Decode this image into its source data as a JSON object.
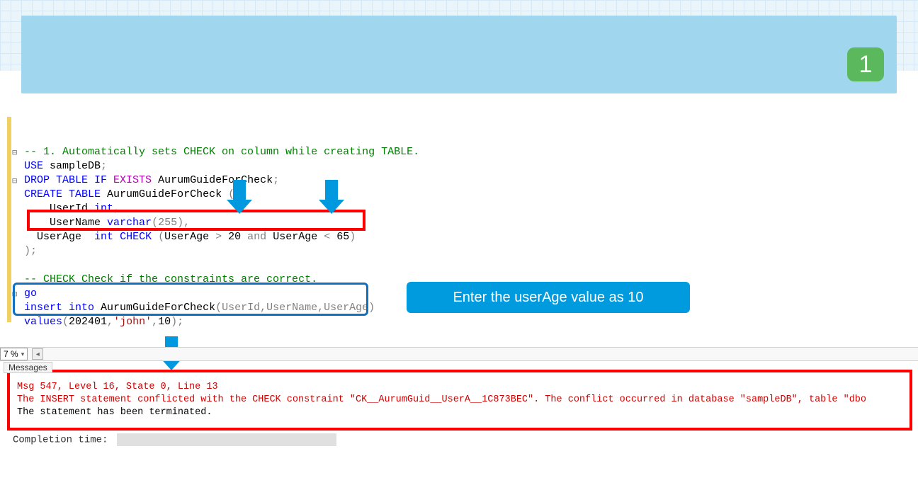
{
  "header": {
    "step_number": "1"
  },
  "code": {
    "comment1": "-- 1. Automatically sets CHECK on column while creating TABLE.",
    "use_kw": "USE",
    "use_db": "sampleDB",
    "drop_kw": "DROP TABLE IF",
    "exists_kw": "EXISTS",
    "drop_tbl": "AurumGuideForCheck",
    "create_kw": "CREATE TABLE",
    "create_tbl": "AurumGuideForCheck",
    "open_paren": "(",
    "col1_name": "UserId",
    "col1_type": "int",
    "comma": ",",
    "col2_name": "UserName",
    "col2_type_kw": "varchar",
    "col2_type_arg": "(255)",
    "col3_name": "UserAge",
    "col3_type": "int",
    "check_kw": "CHECK",
    "check_open": "(",
    "check_c1": "UserAge",
    "check_gt": " > ",
    "check_v1": "20",
    "check_and": " and ",
    "check_c2": "UserAge",
    "check_lt": " < ",
    "check_v2": "65",
    "check_close": ")",
    "close_paren": ");",
    "comment2": "-- CHECK Check if the constraints are correct.",
    "go": "go",
    "insert_kw": "insert into",
    "insert_tbl": "AurumGuideForCheck",
    "insert_cols": "(UserId,UserName,UserAge)",
    "values_kw": "values",
    "values_open": "(",
    "val1": "202401",
    "val_comma": ",",
    "val2": "'john'",
    "val3": "10",
    "values_close": ");"
  },
  "callout": {
    "text": "Enter the userAge value as 10"
  },
  "zoom": {
    "value": "7 %"
  },
  "tab": {
    "messages": "Messages"
  },
  "error": {
    "line1": "Msg 547, Level 16, State 0, Line 13",
    "line2a": "The INSERT statement conflicted with the CHECK constraint \"CK__AurumGuid__UserA__1C873BEC\". The conflict occurred in database \"sampleDB\", table \"dbo",
    "line3": "The statement has been terminated."
  },
  "completion": {
    "label": "Completion time:"
  }
}
